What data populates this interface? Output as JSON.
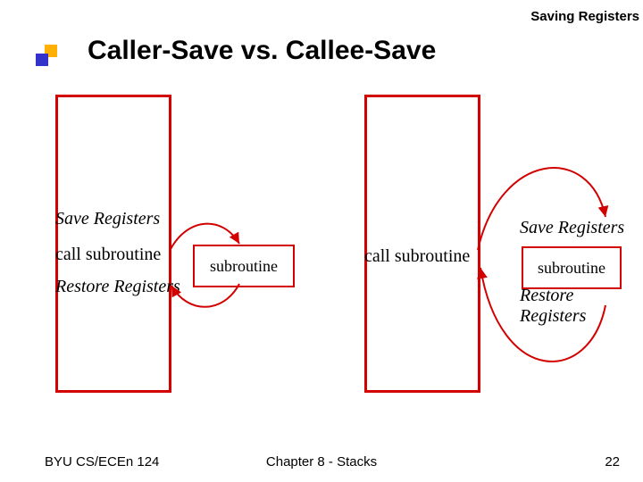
{
  "header": "Saving Registers",
  "title": "Caller-Save vs. Callee-Save",
  "caller": {
    "save": "Save Registers",
    "call": "call subroutine",
    "restore": "Restore Registers",
    "sub": "subroutine"
  },
  "callee": {
    "call": "call subroutine",
    "save": "Save Registers",
    "sub": "subroutine",
    "restore": "Restore Registers"
  },
  "footer": {
    "left": "BYU CS/ECEn 124",
    "center": "Chapter 8 - Stacks",
    "right": "22"
  }
}
